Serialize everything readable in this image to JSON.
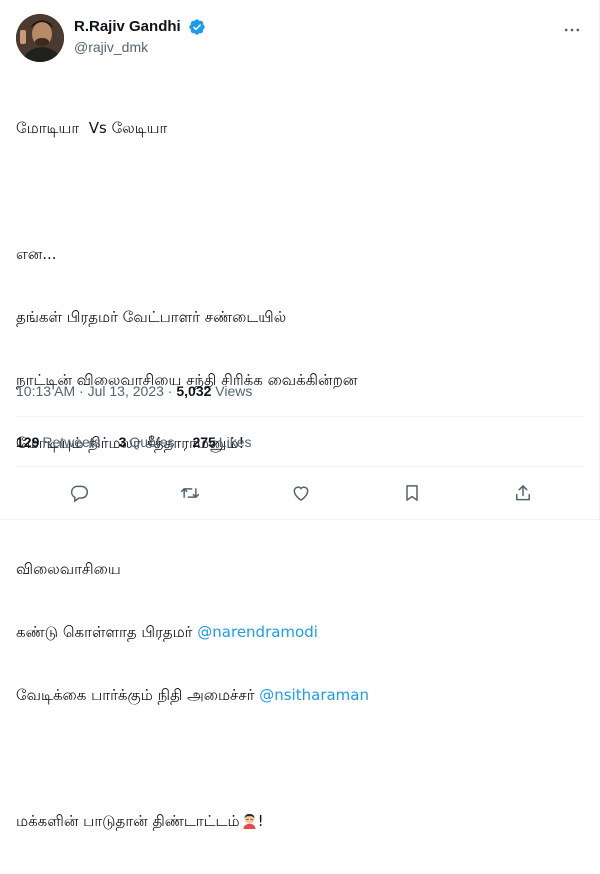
{
  "author": {
    "display_name": "R.Rajiv Gandhi",
    "handle": "@rajiv_dmk",
    "verified": true,
    "avatar_icon": "profile-photo"
  },
  "more_icon": "more-options-icon",
  "tweet": {
    "lines": [
      "மோடியா  Vs லேடியா",
      "",
      "என...",
      "தங்கள் பிரதமர் வேட்பாளர் சண்டையில்",
      "நாட்டின் விலைவாசியை சந்தி சிரிக்க வைக்கின்றன",
      "மோடியும் நிர்மலா சீத்தாராமனும்!",
      "",
      "விலைவாசியை",
      "கண்டு கொள்ளாத பிரதமர் ",
      "வேடிக்கை பார்க்கும் நிதி அமைச்சர் ",
      "",
      "மக்களின் பாடுதான் திண்டாட்டம்",
      "!"
    ],
    "mention_1": "@narendramodi",
    "mention_2": "@nsitharaman",
    "emoji": "face-emoji"
  },
  "meta": {
    "time": "10:13 AM",
    "separator": " · ",
    "date": "Jul 13, 2023",
    "views_count": "5,032",
    "views_label": " Views"
  },
  "stats": {
    "retweets_count": "129",
    "retweets_label": "Retweets",
    "quotes_count": "3",
    "quotes_label": "Quotes",
    "likes_count": "275",
    "likes_label": "Likes"
  },
  "actions": [
    "reply-icon",
    "retweet-icon",
    "like-icon",
    "bookmark-icon",
    "share-icon"
  ],
  "colors": {
    "text": "#0f1419",
    "secondary": "#536471",
    "accent": "#1d9bf0",
    "divider": "#eff3f4"
  }
}
